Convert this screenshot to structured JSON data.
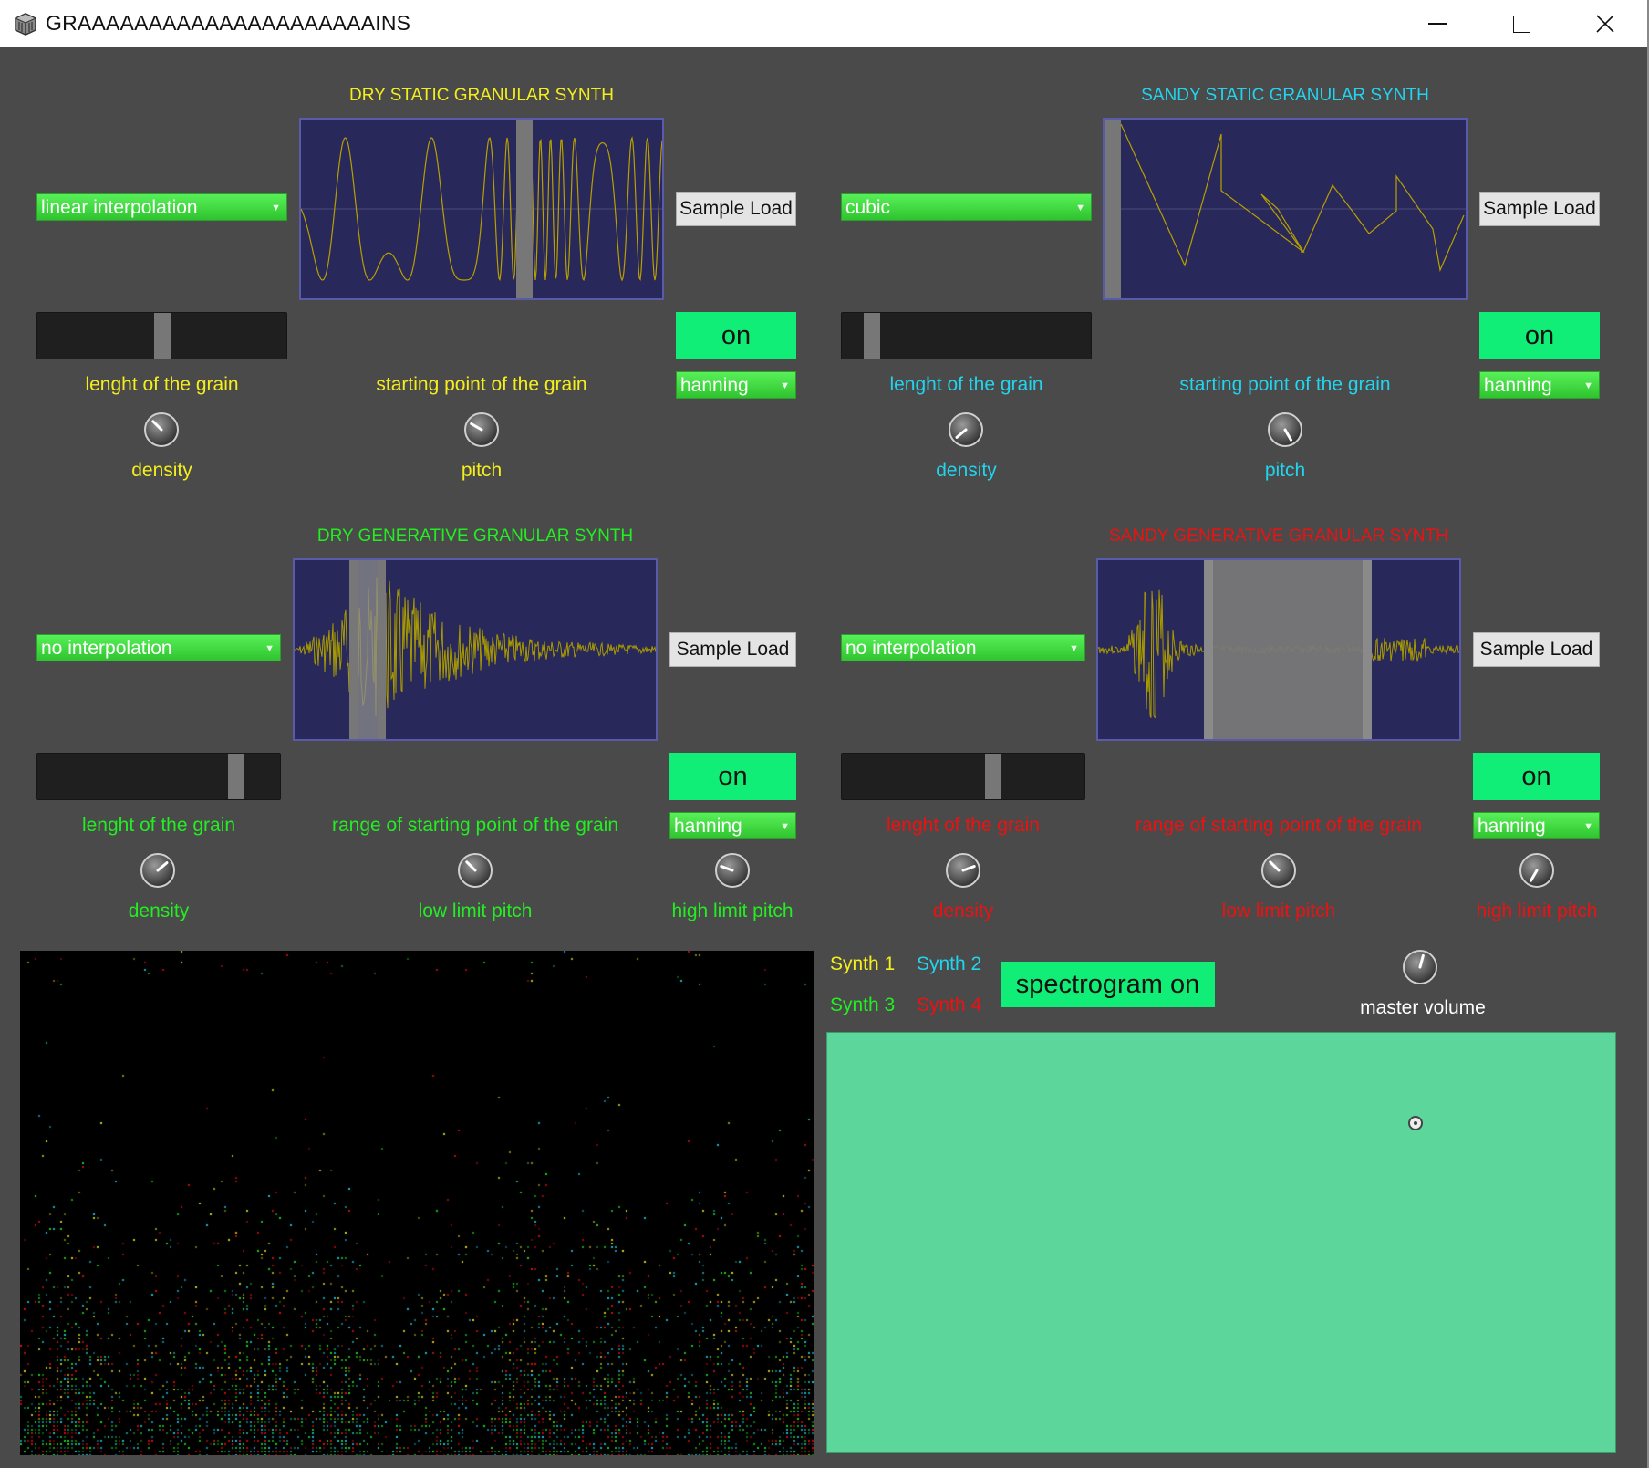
{
  "window": {
    "title": "GRAAAAAAAAAAAAAAAAAAAAAINS",
    "minimize_glyph": "—",
    "maximize_glyph": "☐",
    "close_glyph": "✕"
  },
  "colors": {
    "yellow": "#f4ee1c",
    "cyan": "#22d4ee",
    "green": "#22ee22",
    "red": "#ee1111",
    "on_button": "#11ee77",
    "xy_pad": "#5cd69a"
  },
  "synths": [
    {
      "id": "dry-static",
      "title": "DRY STATIC GRANULAR SYNTH",
      "color": "#f4ee1c",
      "interpolation": "linear interpolation",
      "sample_load": "Sample Load",
      "power": "on",
      "window_type": "hanning",
      "labels": {
        "length": "lenght of the grain",
        "start": "starting point of the grain",
        "density": "density",
        "pitch": "pitch"
      },
      "grain_length_position": 0.5,
      "start_marker_position": 0.62
    },
    {
      "id": "sandy-static",
      "title": "SANDY STATIC GRANULAR SYNTH",
      "color": "#22d4ee",
      "interpolation": "cubic",
      "sample_load": "Sample Load",
      "power": "on",
      "window_type": "hanning",
      "labels": {
        "length": "lenght of the grain",
        "start": "starting point of the grain",
        "density": "density",
        "pitch": "pitch"
      },
      "grain_length_position": 0.12,
      "start_marker_position": 0.03
    },
    {
      "id": "dry-generative",
      "title": "DRY GENERATIVE GRANULAR SYNTH",
      "color": "#22ee22",
      "interpolation": "no interpolation",
      "sample_load": "Sample Load",
      "power": "on",
      "window_type": "hanning",
      "labels": {
        "length": "lenght of the grain",
        "start": "range of starting point of the grain",
        "density": "density",
        "low_pitch": "low limit pitch",
        "high_pitch": "high limit pitch"
      },
      "grain_length_position": 0.82
    },
    {
      "id": "sandy-generative",
      "title": "SANDY GENERATIVE GRANULAR SYNTH",
      "color": "#ee1111",
      "interpolation": "no interpolation",
      "sample_load": "Sample Load",
      "power": "on",
      "window_type": "hanning",
      "labels": {
        "length": "lenght of the grain",
        "start": "range of starting point of the grain",
        "density": "density",
        "low_pitch": "low limit pitch",
        "high_pitch": "high limit pitch"
      },
      "grain_length_position": 0.62
    }
  ],
  "knobs": {
    "dry_static_density": -45,
    "dry_static_pitch": -60,
    "sandy_static_density": -130,
    "sandy_static_pitch": 150,
    "dry_gen_density": 50,
    "dry_gen_low_pitch": -45,
    "dry_gen_high_pitch": -70,
    "sandy_gen_density": 70,
    "sandy_gen_low_pitch": -45,
    "sandy_gen_high_pitch": -150,
    "master_volume": 15
  },
  "bottom": {
    "legend": [
      {
        "label": "Synth 1",
        "color": "#f4ee1c"
      },
      {
        "label": "Synth 2",
        "color": "#22d4ee"
      },
      {
        "label": "Synth 3",
        "color": "#22ee22"
      },
      {
        "label": "Synth 4",
        "color": "#ee1111"
      }
    ],
    "spectrogram_toggle": "spectrogram on",
    "master_volume_label": "master volume"
  }
}
